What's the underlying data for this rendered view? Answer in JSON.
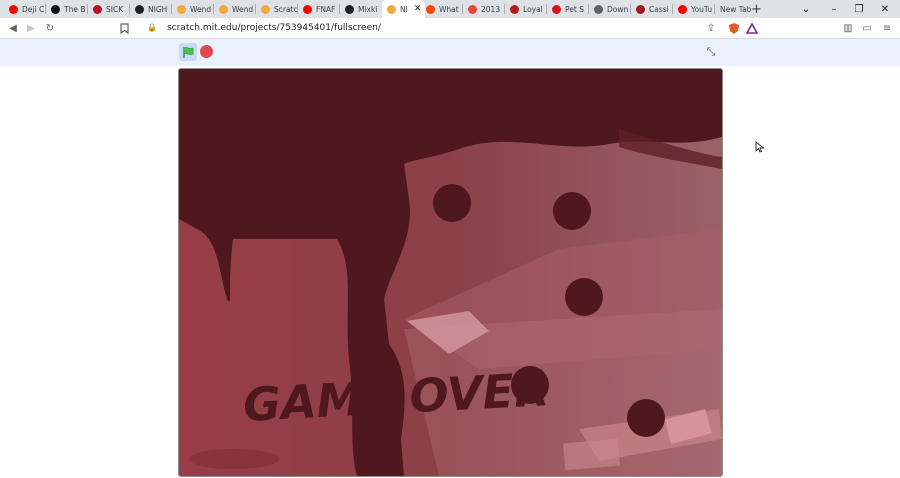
{
  "tabs": [
    {
      "label": "Deji C",
      "icon": "youtube-icon",
      "color": "#ff0000"
    },
    {
      "label": "The B",
      "icon": "tiktok-icon",
      "color": "#111111"
    },
    {
      "label": "SICK",
      "icon": "red-circle-icon",
      "color": "#c0111f"
    },
    {
      "label": "NIGH",
      "icon": "logo-icon",
      "color": "#222222"
    },
    {
      "label": "Wend",
      "icon": "bookmark-icon",
      "color": "#f2a93b"
    },
    {
      "label": "Wend",
      "icon": "bookmark-icon",
      "color": "#f2a93b"
    },
    {
      "label": "Scratc",
      "icon": "bookmark-icon",
      "color": "#f2a93b"
    },
    {
      "label": "FNAF",
      "icon": "youtube-icon",
      "color": "#ff0000"
    },
    {
      "label": "Mixki",
      "icon": "circle-icon",
      "color": "#202124"
    },
    {
      "label": "NI",
      "icon": "bookmark-icon",
      "color": "#f2a93b",
      "active": true
    },
    {
      "label": "What",
      "icon": "reddit-icon",
      "color": "#ff4500"
    },
    {
      "label": "2013",
      "icon": "target-icon",
      "color": "#e8463a"
    },
    {
      "label": "Loyal",
      "icon": "red-circle-icon",
      "color": "#b31c1c"
    },
    {
      "label": "Pet S",
      "icon": "square-icon",
      "color": "#d2151c"
    },
    {
      "label": "Down",
      "icon": "download-icon",
      "color": "#5f6368"
    },
    {
      "label": "Cassi",
      "icon": "red-circle-icon",
      "color": "#9b1b1b"
    },
    {
      "label": "YouTu",
      "icon": "youtube-icon",
      "color": "#ff0000"
    },
    {
      "label": "New Tab",
      "icon": "",
      "color": ""
    }
  ],
  "address": {
    "url": "scratch.mit.edu/projects/753945401/fullscreen/"
  },
  "stage": {
    "text": "GAME OVER"
  },
  "colors": {
    "accent": "#e9f1fc",
    "flag": "#4cbf56",
    "stop": "#e0484f"
  }
}
